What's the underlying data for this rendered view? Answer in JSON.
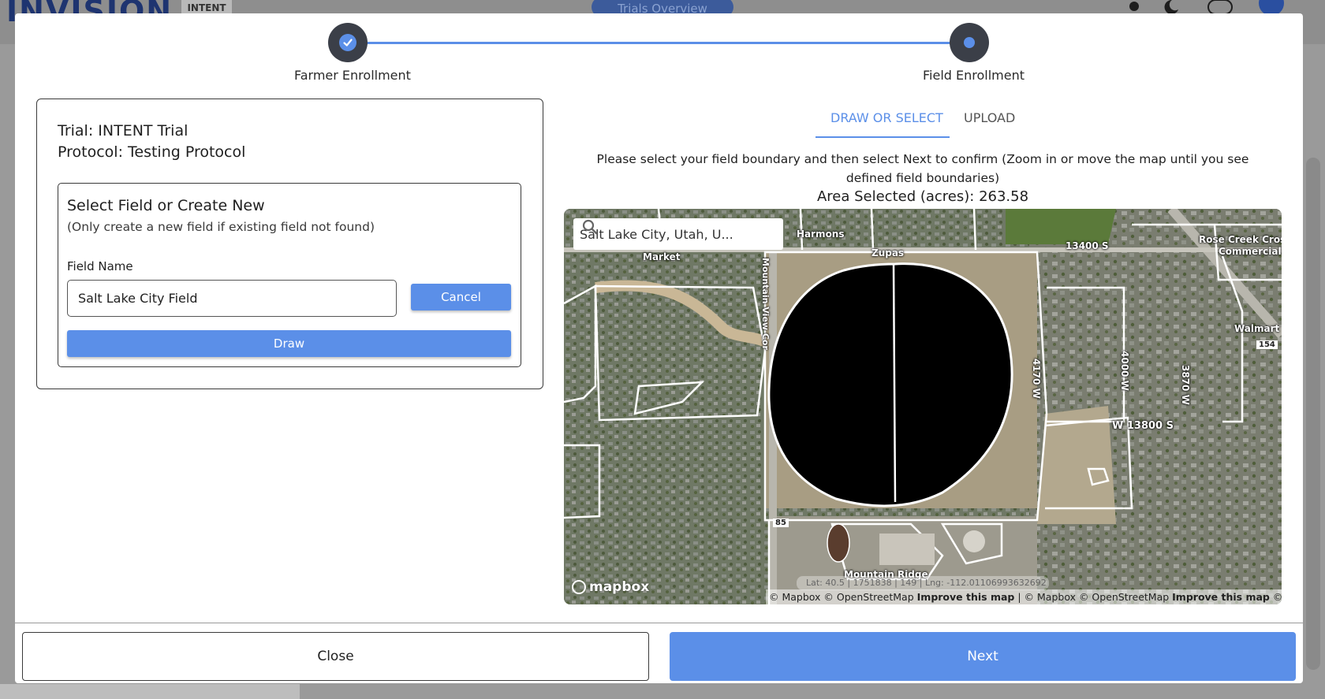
{
  "background": {
    "logo_text": "INVISION",
    "partner_logo_text": "INTENT",
    "header_pill": "Trials Overview"
  },
  "stepper": {
    "steps": [
      {
        "label": "Farmer Enrollment",
        "state": "completed"
      },
      {
        "label": "Field Enrollment",
        "state": "active"
      }
    ]
  },
  "left_panel": {
    "trial": "Trial: INTENT Trial",
    "protocol": "Protocol: Testing Protocol",
    "select_title": "Select Field or Create New",
    "select_subtitle": "(Only create a new field if existing field not found)",
    "field_name_label": "Field Name",
    "field_name_value": "Salt Lake City Field",
    "cancel_label": "Cancel",
    "draw_label": "Draw"
  },
  "right_panel": {
    "tabs": [
      {
        "label": "DRAW OR SELECT",
        "active": true
      },
      {
        "label": "UPLOAD",
        "active": false
      }
    ],
    "instructions": "Please select your field boundary and then select Next to confirm (Zoom in or move the map until you see defined field boundaries)",
    "area_selected": "Area Selected (acres): 263.58"
  },
  "map": {
    "search_value": "Salt Lake City, Utah, U...",
    "labels": {
      "harmons": "Harmons",
      "zupas": "Zupas",
      "market": "Market",
      "street_13400": "13400 S",
      "rose_creek": "Rose Creek Cross",
      "commercial": "Commercial",
      "walmart": "Walmart S",
      "hwy_154": "154",
      "street_4170": "4170 W",
      "street_4000": "4000 W",
      "street_3870": "3870 W",
      "street_13800": "W 13800 S",
      "hwy_85": "85",
      "mountain_ridge": "Mountain Ridge",
      "mountain_view": "Mountain View Cor"
    },
    "logo": "mapbox",
    "coordinates": "Lat: 40.5 | 1751838 | 149 | Lng: -112.01106993632692",
    "attribution": {
      "part1": "© Mapbox © OpenStreetMap",
      "improve1": "Improve this map",
      "part2": "| © Mapbox © OpenStreetMap",
      "improve2": "Improve this map",
      "part3": "© Maxar"
    },
    "colors": {
      "boundary": "#ffffff",
      "selection_fill": "#000000"
    }
  },
  "footer": {
    "close_label": "Close",
    "next_label": "Next"
  },
  "colors": {
    "accent": "#5b8fe8",
    "step_dot": "#3b3f48"
  }
}
